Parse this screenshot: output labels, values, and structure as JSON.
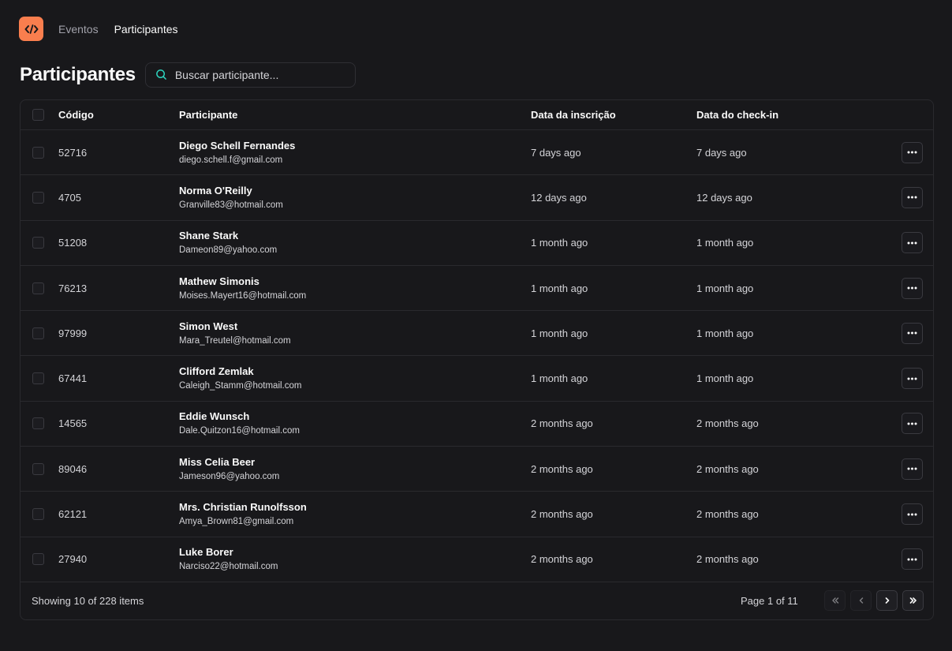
{
  "nav": {
    "logo": "code-brackets-icon",
    "links": [
      "Eventos",
      "Participantes"
    ]
  },
  "page": {
    "title": "Participantes",
    "search_placeholder": "Buscar participante..."
  },
  "table": {
    "columns": [
      "Código",
      "Participante",
      "Data da inscrição",
      "Data do check-in"
    ],
    "rows": [
      {
        "code": "52716",
        "name": "Diego Schell Fernandes",
        "email": "diego.schell.f@gmail.com",
        "registered": "7 days ago",
        "checkin": "7 days ago"
      },
      {
        "code": "4705",
        "name": "Norma O'Reilly",
        "email": "Granville83@hotmail.com",
        "registered": "12 days ago",
        "checkin": "12 days ago"
      },
      {
        "code": "51208",
        "name": "Shane Stark",
        "email": "Dameon89@yahoo.com",
        "registered": "1 month ago",
        "checkin": "1 month ago"
      },
      {
        "code": "76213",
        "name": "Mathew Simonis",
        "email": "Moises.Mayert16@hotmail.com",
        "registered": "1 month ago",
        "checkin": "1 month ago"
      },
      {
        "code": "97999",
        "name": "Simon West",
        "email": "Mara_Treutel@hotmail.com",
        "registered": "1 month ago",
        "checkin": "1 month ago"
      },
      {
        "code": "67441",
        "name": "Clifford Zemlak",
        "email": "Caleigh_Stamm@hotmail.com",
        "registered": "1 month ago",
        "checkin": "1 month ago"
      },
      {
        "code": "14565",
        "name": "Eddie Wunsch",
        "email": "Dale.Quitzon16@hotmail.com",
        "registered": "2 months ago",
        "checkin": "2 months ago"
      },
      {
        "code": "89046",
        "name": "Miss Celia Beer",
        "email": "Jameson96@yahoo.com",
        "registered": "2 months ago",
        "checkin": "2 months ago"
      },
      {
        "code": "62121",
        "name": "Mrs. Christian Runolfsson",
        "email": "Amya_Brown81@gmail.com",
        "registered": "2 months ago",
        "checkin": "2 months ago"
      },
      {
        "code": "27940",
        "name": "Luke Borer",
        "email": "Narciso22@hotmail.com",
        "registered": "2 months ago",
        "checkin": "2 months ago"
      }
    ]
  },
  "footer": {
    "showing": "Showing 10 of 228 items",
    "page_info": "Page 1 of 11"
  },
  "colors": {
    "background": "#18181b",
    "accent": "#f97e4e",
    "border": "#2a2a2e",
    "search_icon": "#2dd4bf"
  }
}
